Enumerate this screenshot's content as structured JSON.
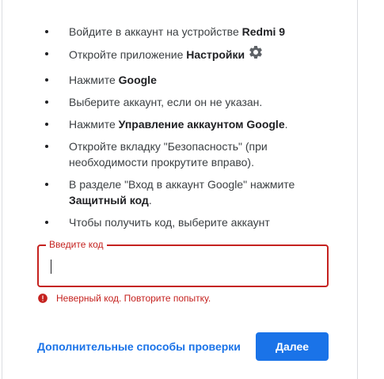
{
  "steps": [
    {
      "text": "Войдите в аккаунт на устройстве ",
      "bold": "Redmi 9",
      "after": ""
    },
    {
      "text": "Откройте приложение ",
      "bold": "Настройки",
      "after": "",
      "icon": "gear-icon"
    },
    {
      "text": "Нажмите ",
      "bold": "Google",
      "after": ""
    },
    {
      "text": "Выберите аккаунт, если он не указан.",
      "bold": "",
      "after": ""
    },
    {
      "text": "Нажмите ",
      "bold": "Управление аккаунтом Google",
      "after": "."
    },
    {
      "text": "Откройте вкладку \"Безопасность\" (при необходимости прокрутите вправо).",
      "bold": "",
      "after": ""
    },
    {
      "text": "В разделе \"Вход в аккаунт Google\" нажмите ",
      "bold": "Защитный код",
      "after": "."
    },
    {
      "text": "Чтобы получить код, выберите аккаунт",
      "bold": "",
      "after": ""
    }
  ],
  "code_field": {
    "label": "Введите код",
    "value": ""
  },
  "error": {
    "text": "Неверный код. Повторите попытку.",
    "icon": "error-icon"
  },
  "actions": {
    "more_options": "Дополнительные способы проверки",
    "next": "Далее"
  },
  "colors": {
    "accent": "#1a73e8",
    "error": "#c5221f"
  }
}
